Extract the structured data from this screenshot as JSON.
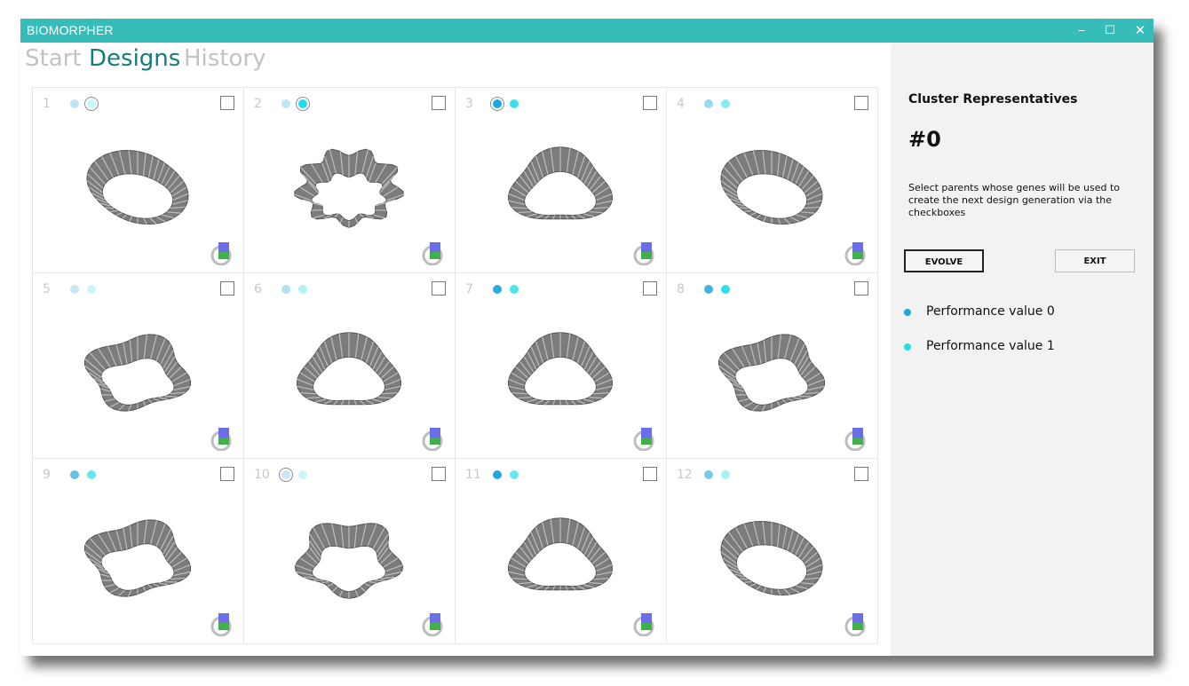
{
  "window": {
    "title": "BIOMORPHER",
    "minimize_glyph": "‒",
    "maximize_glyph": "☐",
    "close_glyph": "✕"
  },
  "nav": {
    "tabs": [
      {
        "label": "Start"
      },
      {
        "label": "Designs"
      },
      {
        "label": "History"
      }
    ],
    "active": "Designs"
  },
  "colors": {
    "titlebar": "#37bdb9",
    "active_tab": "#167b79",
    "perf0": "#1fa8df",
    "perf1": "#24dde8"
  },
  "icons": [
    "minimize-icon",
    "maximize-icon",
    "close-icon",
    "settings-badge-icon"
  ],
  "designs": [
    {
      "number": "1",
      "dot0_level": 0.3,
      "dot1_level": 0.25,
      "dot0_ring": false,
      "dot1_ring": true,
      "checked": false
    },
    {
      "number": "2",
      "dot0_level": 0.3,
      "dot1_level": 1.0,
      "dot0_ring": false,
      "dot1_ring": true,
      "checked": false
    },
    {
      "number": "3",
      "dot0_level": 1.0,
      "dot1_level": 0.9,
      "dot0_ring": true,
      "dot1_ring": false,
      "checked": false
    },
    {
      "number": "4",
      "dot0_level": 0.45,
      "dot1_level": 0.55,
      "dot0_ring": false,
      "dot1_ring": false,
      "checked": false
    },
    {
      "number": "5",
      "dot0_level": 0.25,
      "dot1_level": 0.25,
      "dot0_ring": false,
      "dot1_ring": false,
      "checked": false
    },
    {
      "number": "6",
      "dot0_level": 0.35,
      "dot1_level": 0.35,
      "dot0_ring": false,
      "dot1_ring": false,
      "checked": false
    },
    {
      "number": "7",
      "dot0_level": 0.95,
      "dot1_level": 0.8,
      "dot0_ring": false,
      "dot1_ring": false,
      "checked": false
    },
    {
      "number": "8",
      "dot0_level": 0.85,
      "dot1_level": 0.95,
      "dot0_ring": false,
      "dot1_ring": false,
      "checked": false
    },
    {
      "number": "9",
      "dot0_level": 0.7,
      "dot1_level": 0.7,
      "dot0_ring": false,
      "dot1_ring": false,
      "checked": false
    },
    {
      "number": "10",
      "dot0_level": 0.25,
      "dot1_level": 0.25,
      "dot0_ring": true,
      "dot1_ring": false,
      "checked": false
    },
    {
      "number": "11",
      "dot0_level": 1.0,
      "dot1_level": 0.7,
      "dot0_ring": false,
      "dot1_ring": false,
      "checked": false
    },
    {
      "number": "12",
      "dot0_level": 0.6,
      "dot1_level": 0.4,
      "dot0_ring": false,
      "dot1_ring": false,
      "checked": false
    }
  ],
  "sidebar": {
    "heading": "Cluster Representatives",
    "cluster": "#0",
    "instructions": "Select parents whose genes will be used to create the next design generation via the checkboxes",
    "evolve_label": "EVOLVE",
    "exit_label": "EXIT",
    "legend": [
      {
        "label": "Performance value 0"
      },
      {
        "label": "Performance value 1"
      }
    ]
  }
}
